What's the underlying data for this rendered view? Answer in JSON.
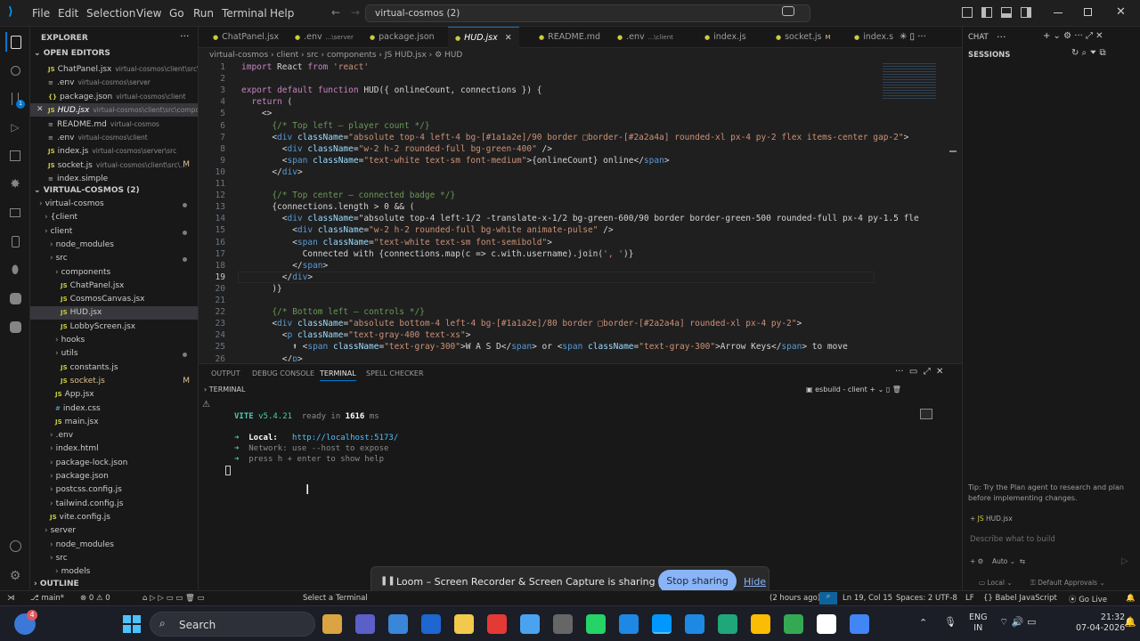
{
  "menu": [
    "File",
    "Edit",
    "Selection",
    "View",
    "Go",
    "Run",
    "Terminal",
    "Help"
  ],
  "command_center": "virtual-cosmos (2)",
  "explorer": {
    "title": "EXPLORER",
    "open_editors_label": "OPEN EDITORS",
    "open_editors": [
      {
        "name": "ChatPanel.jsx",
        "path": "virtual-cosmos\\client\\src\\...",
        "icon": "JS"
      },
      {
        "name": ".env",
        "path": "virtual-cosmos\\server",
        "icon": ""
      },
      {
        "name": "package.json",
        "path": "virtual-cosmos\\client",
        "icon": "{}"
      },
      {
        "name": "HUD.jsx",
        "path": "virtual-cosmos\\client\\src\\compo...",
        "icon": "JS"
      },
      {
        "name": "README.md",
        "path": "virtual-cosmos",
        "icon": ""
      },
      {
        "name": ".env",
        "path": "virtual-cosmos\\client",
        "icon": ""
      },
      {
        "name": "index.js",
        "path": "virtual-cosmos\\server\\src",
        "icon": "JS"
      },
      {
        "name": "socket.js",
        "path": "virtual-cosmos\\client\\src\\...",
        "icon": "JS",
        "mod": "M"
      },
      {
        "name": "index.simple",
        "path": "",
        "icon": ""
      }
    ],
    "workspace_label": "VIRTUAL-COSMOS (2)",
    "tree": [
      {
        "name": "virtual-cosmos",
        "depth": 1,
        "dot": true
      },
      {
        "name": "{client",
        "depth": 2
      },
      {
        "name": "client",
        "depth": 2,
        "dot": true
      },
      {
        "name": "node_modules",
        "depth": 3
      },
      {
        "name": "src",
        "depth": 3,
        "dot": true
      },
      {
        "name": "components",
        "depth": 4
      },
      {
        "name": "ChatPanel.jsx",
        "depth": 5,
        "icon": "JS"
      },
      {
        "name": "CosmosCanvas.jsx",
        "depth": 5,
        "icon": "JS"
      },
      {
        "name": "HUD.jsx",
        "depth": 5,
        "icon": "JS",
        "selected": true
      },
      {
        "name": "LobbyScreen.jsx",
        "depth": 5,
        "icon": "JS"
      },
      {
        "name": "hooks",
        "depth": 4
      },
      {
        "name": "utils",
        "depth": 4,
        "dot": true
      },
      {
        "name": "constants.js",
        "depth": 5,
        "icon": "JS"
      },
      {
        "name": "socket.js",
        "depth": 5,
        "icon": "JS",
        "mod": "M"
      },
      {
        "name": "App.jsx",
        "depth": 4,
        "icon": "JS"
      },
      {
        "name": "index.css",
        "depth": 4,
        "icon": "#"
      },
      {
        "name": "main.jsx",
        "depth": 4,
        "icon": "JS"
      },
      {
        "name": ".env",
        "depth": 3
      },
      {
        "name": "index.html",
        "depth": 3
      },
      {
        "name": "package-lock.json",
        "depth": 3
      },
      {
        "name": "package.json",
        "depth": 3
      },
      {
        "name": "postcss.config.js",
        "depth": 3
      },
      {
        "name": "tailwind.config.js",
        "depth": 3
      },
      {
        "name": "vite.config.js",
        "depth": 3,
        "icon": "JS"
      },
      {
        "name": "server",
        "depth": 2
      },
      {
        "name": "node_modules",
        "depth": 3
      },
      {
        "name": "src",
        "depth": 3
      },
      {
        "name": "models",
        "depth": 4
      }
    ],
    "outline_label": "OUTLINE"
  },
  "tabs": [
    {
      "label": "ChatPanel.jsx",
      "hint": ""
    },
    {
      "label": ".env",
      "hint": "...\\server"
    },
    {
      "label": "package.json",
      "hint": ""
    },
    {
      "label": "HUD.jsx",
      "hint": "",
      "active": true
    },
    {
      "label": "README.md",
      "hint": ""
    },
    {
      "label": ".env",
      "hint": "...\\client"
    },
    {
      "label": "index.js",
      "hint": ""
    },
    {
      "label": "socket.js",
      "hint": "M"
    },
    {
      "label": "index.s",
      "hint": ""
    }
  ],
  "breadcrumb": "virtual-cosmos  ›  client  ›  src  ›  components  ›  JS HUD.jsx  ›  ⚙ HUD",
  "code_lines": [
    "import React from 'react'",
    "",
    "export default function HUD({ onlineCount, connections }) {",
    "  return (",
    "    <>",
    "      {/* Top left — player count */}",
    "      <div className=\"absolute top-4 left-4 bg-[#1a1a2e]/90 border □border-[#2a2a4a] rounded-xl px-4 py-2 flex items-center gap-2\">",
    "        <div className=\"w-2 h-2 rounded-full bg-green-400\" />",
    "        <span className=\"text-white text-sm font-medium\">{onlineCount} online</span>",
    "      </div>",
    "",
    "      {/* Top center — connected badge */}",
    "      {connections.length > 0 && (",
    "        <div className=\"absolute top-4 left-1/2 -translate-x-1/2 bg-green-600/90 border border-green-500 rounded-full px-4 py-1.5 fle",
    "          <div className=\"w-2 h-2 rounded-full bg-white animate-pulse\" />",
    "          <span className=\"text-white text-sm font-semibold\">",
    "            Connected with {connections.map(c => c.with.username).join(', ')}",
    "          </span>",
    "        </div>",
    "      )}",
    "",
    "      {/* Bottom left — controls */}",
    "      <div className=\"absolute bottom-4 left-4 bg-[#1a1a2e]/80 border □border-[#2a2a4a] rounded-xl px-4 py-2\">",
    "        <p className=\"text-gray-400 text-xs\">",
    "          ⬆ <span className=\"text-gray-300\">W A S D</span> or <span className=\"text-gray-300\">Arrow Keys</span> to move",
    "        </p>"
  ],
  "panel": {
    "tabs": [
      "OUTPUT",
      "DEBUG CONSOLE",
      "TERMINAL",
      "SPELL CHECKER"
    ],
    "terminal_label": "TERMINAL",
    "instance": "esbuild - client",
    "vite": "VITE",
    "vite_version": "v5.4.21",
    "ready": "ready in",
    "ready_ms": "1616",
    "ms": "ms",
    "local_label": "Local:",
    "local_url": "http://localhost:5173/",
    "network": "Network: use --host to expose",
    "help": "press h + enter to show help"
  },
  "chat": {
    "title": "CHAT",
    "sessions": "SESSIONS",
    "tip": "Tip: Try the Plan agent to research and plan before implementing changes.",
    "file_chip": "HUD.jsx",
    "placeholder": "Describe what to build",
    "mode": "Auto",
    "local": "Local",
    "approvals": "Default Approvals"
  },
  "status": {
    "branch": "main*",
    "errors": "0",
    "warnings": "0",
    "select_terminal": "Select a Terminal",
    "blame": "(2 hours ago)",
    "position": "Ln 19, Col 15",
    "spaces": "Spaces: 2",
    "encoding": "UTF-8",
    "eol": "LF",
    "language": "Babel JavaScript",
    "golive": "Go Live"
  },
  "loom": {
    "message": "Loom – Screen Recorder & Screen Capture is sharing your screen.",
    "stop": "Stop sharing",
    "hide": "Hide"
  },
  "taskbar": {
    "search": "Search",
    "lang1": "ENG",
    "lang2": "IN",
    "time": "21:32",
    "date": "07-04-2026",
    "badge": "4"
  },
  "colors": {
    "accent": "#0078d4",
    "js": "#cbcb41",
    "keyword": "#c586c0",
    "tag": "#569cd6",
    "attr": "#9cdcfe",
    "string": "#ce9178",
    "comment": "#6a9955",
    "func": "#dcdcaa",
    "loom_btn": "#8ab4f8"
  }
}
